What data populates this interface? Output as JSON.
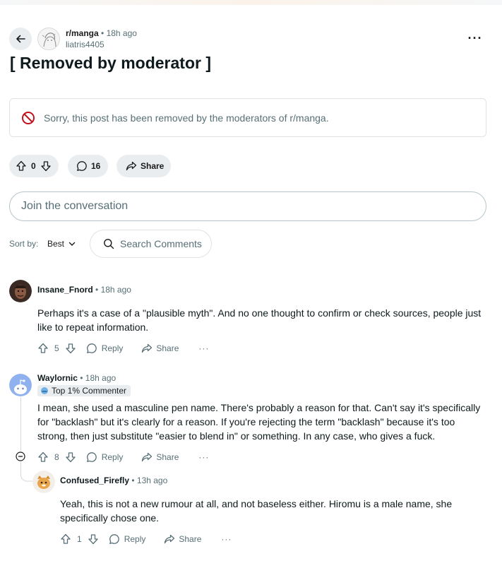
{
  "post": {
    "subreddit": "r/manga",
    "time": "18h ago",
    "author": "liatris4405",
    "title": "[ Removed by moderator ]",
    "removed_message": "Sorry, this post has been removed by the moderators of r/manga.",
    "votes": "0",
    "comments": "16",
    "share_label": "Share",
    "more_label": "···"
  },
  "join": {
    "placeholder": "Join the conversation"
  },
  "sort": {
    "label": "Sort by:",
    "value": "Best",
    "search_placeholder": "Search Comments"
  },
  "separator": "•",
  "comments": [
    {
      "author": "Insane_Fnord",
      "time": "18h ago",
      "body": "Perhaps it's a case of a \"plausible myth\". And no one thought to confirm or check sources, people just like to repeat information.",
      "votes": "5",
      "reply_label": "Reply",
      "share_label": "Share",
      "more_label": "···"
    },
    {
      "author": "Waylornic",
      "time": "18h ago",
      "badge": "Top 1% Commenter",
      "body": "I mean, she used a masculine pen name. There's probably a reason for that. Can't say it's specifically for \"backlash\" but it's clearly for a reason. If you're rejecting the term \"backlash\" because it's too strong, then just substitute \"easier to blend in\" or something. In any case, who gives a fuck.",
      "votes": "8",
      "reply_label": "Reply",
      "share_label": "Share",
      "more_label": "···"
    },
    {
      "author": "Confused_Firefly",
      "time": "13h ago",
      "body": "Yeah, this is not a new rumour at all, and not baseless either. Hiromu is a male name, she specifically chose one.",
      "votes": "1",
      "reply_label": "Reply",
      "share_label": "Share",
      "more_label": "···"
    }
  ],
  "colors": {
    "text": "#0f1a1c",
    "muted": "#576f76",
    "pill": "#eaedef",
    "danger": "#c1121f",
    "border": "#dfe3e5"
  }
}
